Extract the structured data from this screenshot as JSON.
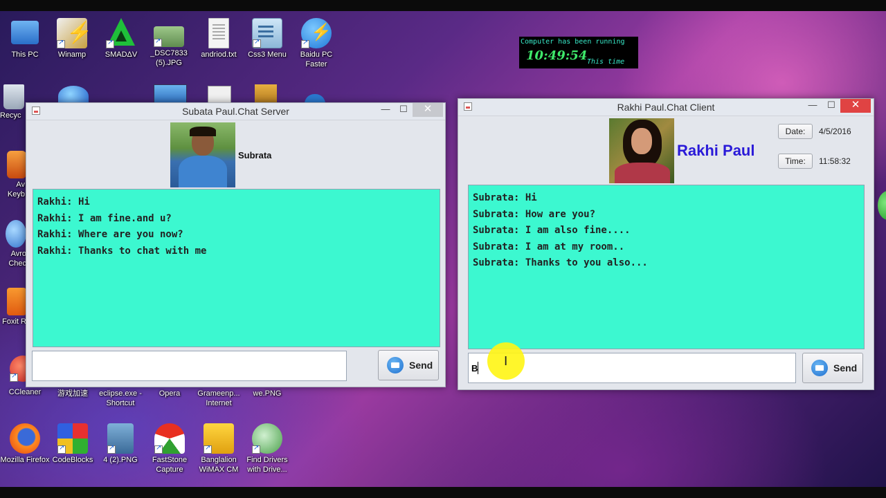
{
  "desktop": {
    "icons": [
      {
        "label": "This PC",
        "icon": "computer-icon"
      },
      {
        "label": "Winamp",
        "icon": "winamp-icon"
      },
      {
        "label": "SMADΔV",
        "icon": "smadav-icon"
      },
      {
        "label": "_DSC7833 (5).JPG",
        "icon": "photo-file-icon"
      },
      {
        "label": "andriod.txt",
        "icon": "text-file-icon"
      },
      {
        "label": "Css3 Menu",
        "icon": "css3-menu-icon"
      },
      {
        "label": "Baidu PC Faster",
        "icon": "baidu-icon"
      },
      {
        "label": "Recyc",
        "icon": "recycle-bin-icon"
      },
      {
        "label": "Av Keyb",
        "icon": "avro-keyboard-icon"
      },
      {
        "label": "Avro Chec",
        "icon": "avro-checker-icon"
      },
      {
        "label": "Foxit R",
        "icon": "foxit-reader-icon"
      },
      {
        "label": "CCleaner",
        "icon": "ccleaner-icon"
      },
      {
        "label": "游戏加速",
        "icon": "game-accelerator-icon"
      },
      {
        "label": "eclipse.exe - Shortcut",
        "icon": "eclipse-icon"
      },
      {
        "label": "Opera",
        "icon": "opera-icon"
      },
      {
        "label": "Grameenp... Internet",
        "icon": "grameenphone-icon"
      },
      {
        "label": "we.PNG",
        "icon": "png-file-icon"
      },
      {
        "label": "Mozilla Firefox",
        "icon": "firefox-icon"
      },
      {
        "label": "CodeBlocks",
        "icon": "codeblocks-icon"
      },
      {
        "label": "4 (2).PNG",
        "icon": "photo-file-icon"
      },
      {
        "label": "FastStone Capture",
        "icon": "faststone-icon"
      },
      {
        "label": "Banglalion WiMAX CM",
        "icon": "banglalion-icon"
      },
      {
        "label": "Find Drivers with Drive...",
        "icon": "find-drivers-icon"
      }
    ]
  },
  "uptime_widget": {
    "line1": "Computer has been running",
    "time": "10:49:54",
    "line3": "This time"
  },
  "server_window": {
    "title": "Subata Paul.Chat Server",
    "user_name": "Subrata",
    "messages": [
      "Rakhi: Hi",
      "Rakhi: I am fine.and u?",
      "Rakhi: Where are you now?",
      "Rakhi: Thanks to chat with me"
    ],
    "input_value": "",
    "send_label": "Send"
  },
  "client_window": {
    "title": "Rakhi Paul.Chat Client",
    "user_name": "Rakhi Paul",
    "date_label": "Date:",
    "date_value": "4/5/2016",
    "time_label": "Time:",
    "time_value": "11:58:32",
    "messages": [
      "Subrata: Hi",
      "Subrata: How are you?",
      "Subrata: I am also fine....",
      "Subrata: I am at my room..",
      "Subrata: Thanks to you also..."
    ],
    "input_value": "B",
    "send_label": "Send"
  },
  "window_controls": {
    "minimize": "—",
    "maximize": "☐",
    "close": "✕"
  },
  "colors": {
    "chat_bg": "#3cf8d0",
    "client_name": "#2a1ad8",
    "cursor_highlight": "#fff514"
  }
}
